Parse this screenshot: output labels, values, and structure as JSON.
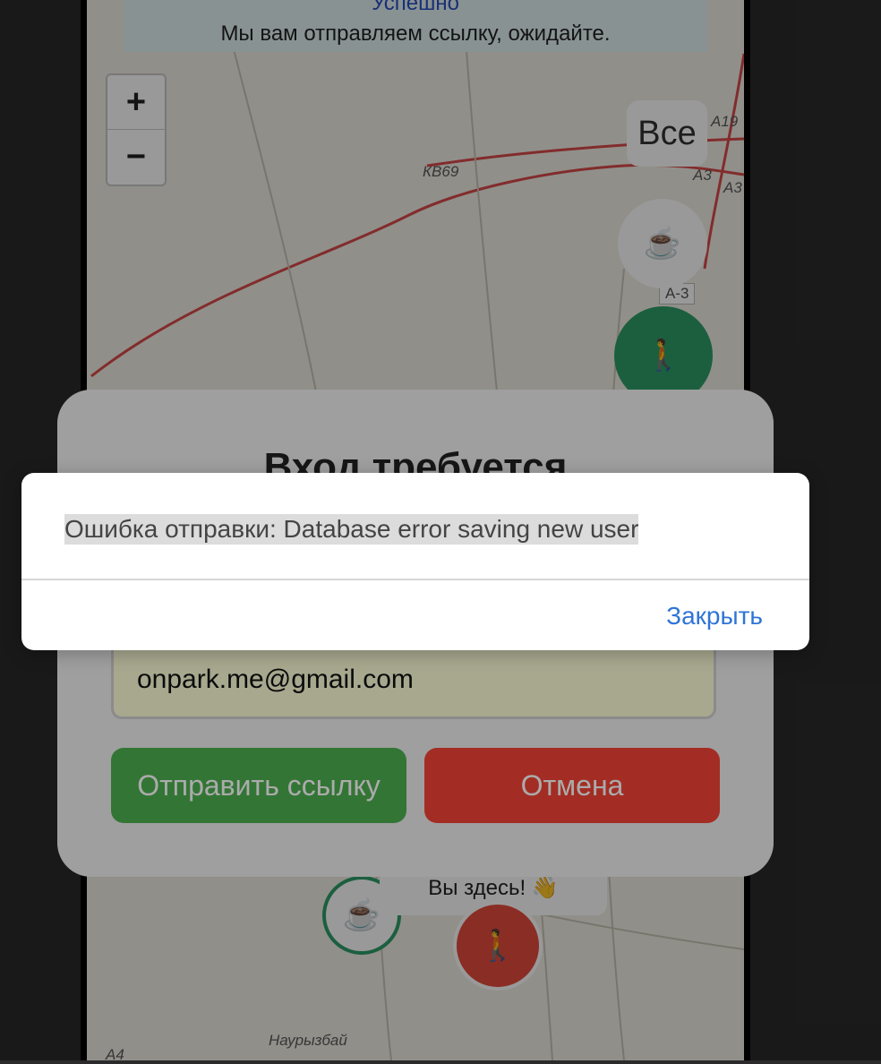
{
  "map": {
    "banner_title": "Успешно",
    "banner_message": "Мы вам отправляем ссылку, ожидайте.",
    "zoom_in": "+",
    "zoom_out": "−",
    "filter_all": "Все",
    "labels": {
      "kb69": "КВ69",
      "a19": "А19",
      "a3_1": "А3",
      "a3_2": "А3",
      "a3_badge": "А-3",
      "a4": "А4",
      "nauryzbai": "Наурызбай"
    },
    "you_are_here": "Вы здесь! 👋",
    "icons": {
      "cafe": "☕",
      "walker": "🚶"
    }
  },
  "login_modal": {
    "title": "Вход требуется",
    "email_value": "onpark.me@gmail.com",
    "send_button": "Отправить ссылку",
    "cancel_button": "Отмена"
  },
  "alert": {
    "message": "Ошибка отправки: Database error saving new user",
    "close_button": "Закрыть"
  },
  "colors": {
    "send": "#4caf50",
    "cancel": "#f44336",
    "link": "#2f74d6"
  }
}
